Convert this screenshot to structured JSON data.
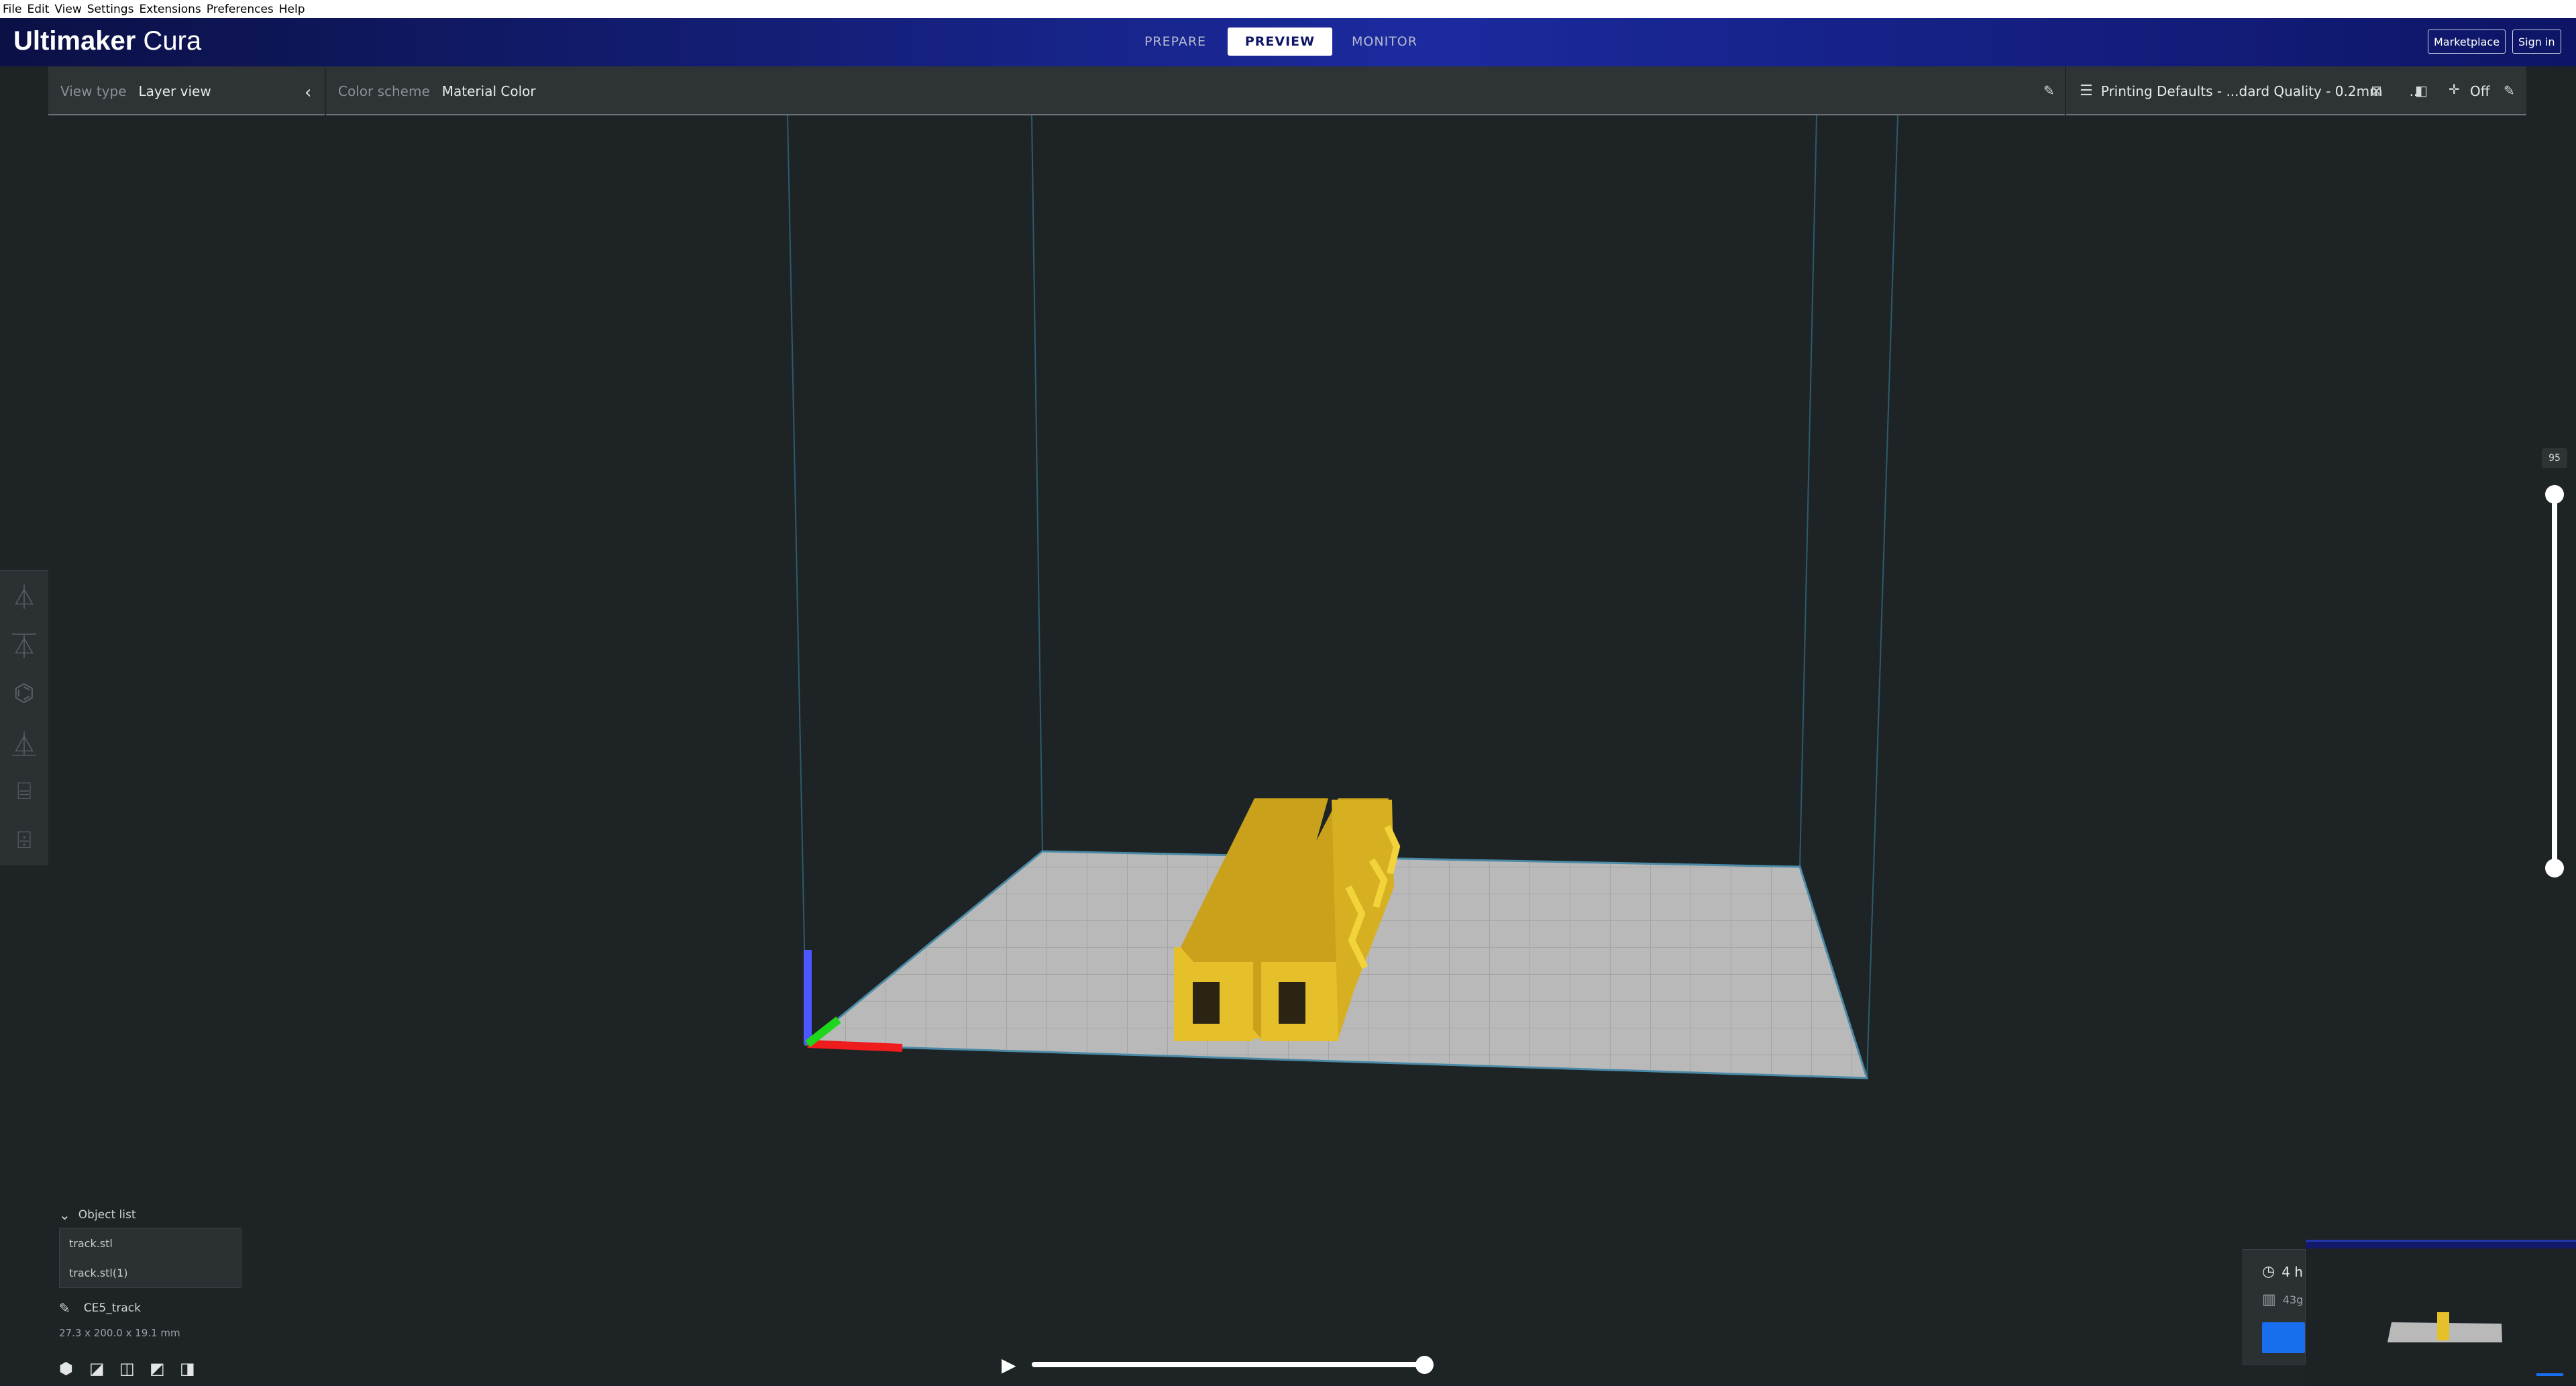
{
  "os_menu": [
    "File",
    "Edit",
    "View",
    "Settings",
    "Extensions",
    "Preferences",
    "Help"
  ],
  "app": {
    "logo_bold": "Ultimaker",
    "logo_light": " Cura"
  },
  "stages": [
    {
      "label": "PREPARE",
      "active": false
    },
    {
      "label": "PREVIEW",
      "active": true
    },
    {
      "label": "MONITOR",
      "active": false
    }
  ],
  "header_buttons": {
    "marketplace": "Marketplace",
    "sign_in": "Sign in"
  },
  "view_toolbar": {
    "view_type_label": "View type",
    "view_type_value": "Layer view",
    "color_scheme_label": "Color scheme",
    "color_scheme_value": "Material Color",
    "profile": "Printing Defaults - ...dard Quality - 0.2mm",
    "profile_more": "...",
    "support_value": "Off"
  },
  "left_tools": [
    "move-icon",
    "scale-icon",
    "rotate-icon",
    "mirror-icon",
    "per-model-settings-icon",
    "support-blocker-icon"
  ],
  "layer_slider": {
    "max_layer": "95",
    "top_fraction": 1.0,
    "bottom_fraction": 0.0
  },
  "object_list": {
    "header": "Object list",
    "items": [
      "track.stl",
      "track.stl(1)"
    ],
    "job_name": "CE5_track",
    "dimensions": "27.3 x 200.0 x 19.1 mm"
  },
  "camera_views": [
    "3d-view-icon",
    "front-view-icon",
    "top-view-icon",
    "left-view-icon",
    "right-view-icon"
  ],
  "simulation": {
    "progress": 1.0
  },
  "print_info": {
    "time": "4 h",
    "weight": "43g"
  },
  "colors": {
    "header_dark": "#0b1045",
    "header_mid": "#1b2a9e",
    "background": "#1e2426",
    "model_yellow": "#e6c02a",
    "build_plate": "#b9b9b9",
    "accent_blue": "#196ef0"
  }
}
